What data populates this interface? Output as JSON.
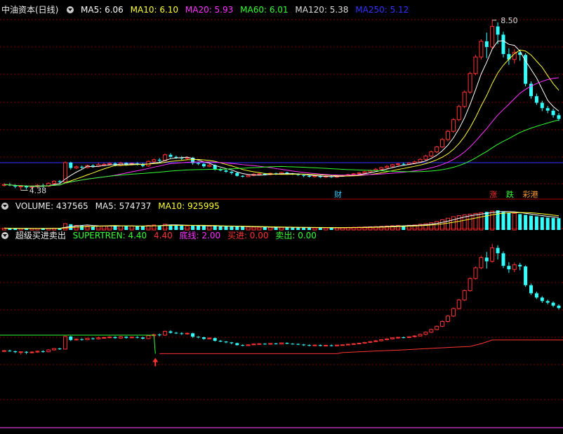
{
  "panel1": {
    "title": "中油资本(日线)",
    "ma": [
      {
        "label": "MA5: 6.06",
        "color": "#ffffff"
      },
      {
        "label": "MA10: 6.10",
        "color": "#ffff33"
      },
      {
        "label": "MA20: 5.93",
        "color": "#ff33ff"
      },
      {
        "label": "MA60: 6.01",
        "color": "#33ff33"
      },
      {
        "label": "MA120: 5.38",
        "color": "#dddddd"
      },
      {
        "label": "MA250: 5.12",
        "color": "#3333ff"
      }
    ],
    "high_label": "8.50",
    "low_label": "4.38",
    "markers": [
      {
        "text": "财",
        "color": "#33ccff",
        "idx": 60
      },
      {
        "text": "涨",
        "color": "#ff3333",
        "idx": 88
      },
      {
        "text": "跌",
        "color": "#33ff33",
        "idx": 91
      },
      {
        "text": "彩港",
        "color": "#ff9933",
        "idx": 94
      }
    ]
  },
  "panel2": {
    "title": "VOLUME: 437565",
    "ma5": "MA5: 574737",
    "ma10": "MA10: 925995"
  },
  "panel3": {
    "title": "超级买进卖出",
    "labels": [
      {
        "text": "SUPERTREN: 4.40",
        "color": "#33ff33"
      },
      {
        "text": "4.40",
        "color": "#ff3333"
      },
      {
        "text": "底线: 2.00",
        "color": "#ff33ff"
      },
      {
        "text": "买进: 0.00",
        "color": "#ff3333"
      },
      {
        "text": "卖出: 0.00",
        "color": "#33ff33"
      }
    ]
  },
  "colors": {
    "up": "#ff3333",
    "down": "#33ffff",
    "grid": "#800000",
    "sep": "#aa0000"
  },
  "chart_data": {
    "type": "candlestick",
    "candles": [
      [
        4.5,
        4.52,
        4.47,
        4.55
      ],
      [
        4.52,
        4.5,
        4.48,
        4.56
      ],
      [
        4.5,
        4.47,
        4.43,
        4.52
      ],
      [
        4.47,
        4.48,
        4.38,
        4.5
      ],
      [
        4.48,
        4.45,
        4.4,
        4.5
      ],
      [
        4.45,
        4.47,
        4.42,
        4.5
      ],
      [
        4.47,
        4.5,
        4.44,
        4.53
      ],
      [
        4.5,
        4.48,
        4.45,
        4.54
      ],
      [
        4.48,
        4.55,
        4.46,
        4.57
      ],
      [
        4.55,
        4.6,
        4.52,
        4.62
      ],
      [
        4.6,
        4.58,
        4.55,
        4.63
      ],
      [
        4.58,
        5.05,
        4.57,
        5.08
      ],
      [
        5.05,
        4.92,
        4.88,
        5.07
      ],
      [
        4.92,
        4.95,
        4.9,
        4.98
      ],
      [
        4.95,
        4.93,
        4.9,
        4.98
      ],
      [
        4.93,
        4.98,
        4.91,
        5.0
      ],
      [
        4.98,
        4.96,
        4.93,
        5.01
      ],
      [
        4.96,
        5.0,
        4.94,
        5.05
      ],
      [
        5.0,
        5.01,
        4.97,
        5.04
      ],
      [
        5.01,
        5.03,
        4.98,
        5.06
      ],
      [
        5.03,
        4.99,
        4.96,
        5.06
      ],
      [
        4.99,
        5.04,
        4.96,
        5.07
      ],
      [
        5.04,
        5.0,
        4.97,
        5.06
      ],
      [
        5.0,
        5.03,
        4.98,
        5.05
      ],
      [
        5.03,
        5.01,
        4.98,
        5.06
      ],
      [
        5.01,
        4.97,
        4.94,
        5.04
      ],
      [
        4.97,
        5.08,
        4.95,
        5.1
      ],
      [
        5.08,
        5.12,
        5.05,
        5.15
      ],
      [
        5.12,
        5.1,
        5.06,
        5.16
      ],
      [
        5.1,
        5.24,
        5.08,
        5.27
      ],
      [
        5.24,
        5.19,
        5.16,
        5.28
      ],
      [
        5.19,
        5.17,
        5.14,
        5.22
      ],
      [
        5.17,
        5.15,
        5.11,
        5.21
      ],
      [
        5.15,
        5.17,
        5.12,
        5.2
      ],
      [
        5.17,
        5.04,
        5.0,
        5.19
      ],
      [
        5.04,
        5.02,
        4.99,
        5.06
      ],
      [
        5.02,
        4.96,
        4.93,
        5.04
      ],
      [
        4.96,
        4.99,
        4.94,
        5.02
      ],
      [
        4.99,
        4.89,
        4.86,
        5.01
      ],
      [
        4.89,
        4.86,
        4.84,
        4.92
      ],
      [
        4.86,
        4.83,
        4.8,
        4.88
      ],
      [
        4.83,
        4.8,
        4.76,
        4.85
      ],
      [
        4.8,
        4.73,
        4.71,
        4.82
      ],
      [
        4.73,
        4.71,
        4.69,
        4.75
      ],
      [
        4.71,
        4.74,
        4.7,
        4.76
      ],
      [
        4.74,
        4.77,
        4.72,
        4.79
      ],
      [
        4.77,
        4.78,
        4.75,
        4.8
      ],
      [
        4.78,
        4.76,
        4.74,
        4.8
      ],
      [
        4.76,
        4.79,
        4.74,
        4.81
      ],
      [
        4.79,
        4.77,
        4.75,
        4.81
      ],
      [
        4.77,
        4.81,
        4.75,
        4.83
      ],
      [
        4.81,
        4.78,
        4.76,
        4.83
      ],
      [
        4.78,
        4.77,
        4.75,
        4.8
      ],
      [
        4.77,
        4.75,
        4.73,
        4.79
      ],
      [
        4.75,
        4.73,
        4.7,
        4.77
      ],
      [
        4.73,
        4.71,
        4.69,
        4.75
      ],
      [
        4.71,
        4.73,
        4.69,
        4.75
      ],
      [
        4.73,
        4.7,
        4.68,
        4.75
      ],
      [
        4.7,
        4.72,
        4.68,
        4.74
      ],
      [
        4.72,
        4.7,
        4.68,
        4.75
      ],
      [
        4.7,
        4.73,
        4.68,
        4.75
      ],
      [
        4.73,
        4.74,
        4.71,
        4.76
      ],
      [
        4.74,
        4.76,
        4.72,
        4.78
      ],
      [
        4.76,
        4.78,
        4.74,
        4.8
      ],
      [
        4.78,
        4.8,
        4.76,
        4.82
      ],
      [
        4.8,
        4.83,
        4.78,
        4.85
      ],
      [
        4.83,
        4.86,
        4.81,
        4.88
      ],
      [
        4.86,
        4.89,
        4.84,
        4.92
      ],
      [
        4.89,
        4.93,
        4.87,
        4.95
      ],
      [
        4.93,
        4.96,
        4.9,
        4.99
      ],
      [
        4.96,
        5.0,
        4.94,
        5.02
      ],
      [
        5.0,
        5.02,
        4.97,
        5.04
      ],
      [
        5.02,
        5.01,
        4.98,
        5.05
      ],
      [
        5.01,
        5.04,
        4.99,
        5.06
      ],
      [
        5.04,
        5.07,
        5.02,
        5.1
      ],
      [
        5.07,
        5.13,
        5.05,
        5.16
      ],
      [
        5.13,
        5.21,
        5.1,
        5.24
      ],
      [
        5.21,
        5.31,
        5.18,
        5.34
      ],
      [
        5.31,
        5.43,
        5.28,
        5.46
      ],
      [
        5.43,
        5.61,
        5.4,
        5.65
      ],
      [
        5.61,
        5.81,
        5.57,
        5.85
      ],
      [
        5.81,
        6.09,
        5.77,
        6.13
      ],
      [
        6.09,
        6.41,
        6.05,
        6.45
      ],
      [
        6.41,
        6.76,
        6.37,
        6.8
      ],
      [
        6.76,
        7.21,
        6.72,
        7.25
      ],
      [
        7.21,
        7.61,
        7.17,
        7.66
      ],
      [
        7.61,
        7.99,
        7.55,
        8.04
      ],
      [
        7.99,
        7.85,
        7.58,
        8.2
      ],
      [
        7.85,
        8.35,
        7.8,
        8.5
      ],
      [
        8.35,
        8.15,
        7.92,
        8.45
      ],
      [
        8.15,
        7.68,
        7.6,
        8.22
      ],
      [
        7.68,
        7.55,
        7.42,
        7.82
      ],
      [
        7.55,
        7.72,
        7.45,
        7.8
      ],
      [
        7.72,
        7.66,
        7.52,
        7.79
      ],
      [
        7.66,
        6.96,
        6.9,
        7.7
      ],
      [
        6.96,
        6.66,
        6.6,
        7.02
      ],
      [
        6.66,
        6.5,
        6.45,
        6.72
      ],
      [
        6.5,
        6.37,
        6.3,
        6.55
      ],
      [
        6.37,
        6.31,
        6.25,
        6.42
      ],
      [
        6.31,
        6.2,
        6.14,
        6.36
      ],
      [
        6.2,
        6.11,
        6.06,
        6.25
      ]
    ],
    "volume": [
      120,
      110,
      100,
      95,
      90,
      95,
      100,
      105,
      110,
      120,
      115,
      420,
      380,
      300,
      280,
      260,
      250,
      260,
      270,
      280,
      260,
      270,
      280,
      260,
      250,
      240,
      300,
      330,
      310,
      380,
      350,
      300,
      280,
      270,
      300,
      280,
      260,
      250,
      270,
      240,
      230,
      220,
      250,
      220,
      200,
      190,
      180,
      185,
      180,
      175,
      180,
      170,
      165,
      160,
      170,
      160,
      150,
      155,
      150,
      145,
      150,
      160,
      170,
      180,
      190,
      200,
      210,
      220,
      240,
      260,
      280,
      300,
      290,
      310,
      330,
      380,
      420,
      480,
      560,
      680,
      780,
      880,
      950,
      1000,
      1050,
      1100,
      1150,
      1200,
      1250,
      1300,
      1200,
      1150,
      1100,
      1050,
      1000,
      950,
      900,
      850,
      820,
      800,
      780
    ],
    "supertrend_green": [
      {
        "from": 0,
        "to": 27,
        "value": 5.1
      }
    ],
    "supertrend_red": [
      [
        28,
        4.41
      ],
      [
        60,
        4.41
      ],
      [
        61,
        4.45
      ],
      [
        66,
        4.5
      ],
      [
        72,
        4.55
      ],
      [
        78,
        4.62
      ],
      [
        84,
        4.68
      ],
      [
        86,
        4.78
      ],
      [
        88,
        4.92
      ],
      [
        101,
        4.92
      ]
    ],
    "buy_signal_idx": 27,
    "bottom_line": 2.0
  }
}
